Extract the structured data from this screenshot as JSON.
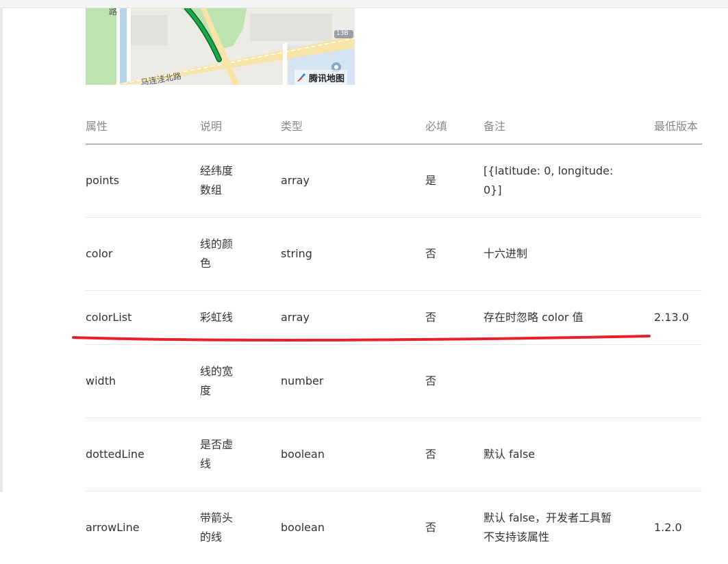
{
  "map": {
    "road_labels": [
      "路",
      "马连洼北路",
      "13B"
    ],
    "brand": "腾讯地图",
    "colors": {
      "route": "#1aa64a",
      "park": "#bfe3b0",
      "water": "#b8d4ec",
      "road": "#f7e4a8"
    }
  },
  "table": {
    "headers": [
      "属性",
      "说明",
      "类型",
      "必填",
      "备注",
      "最低版本"
    ],
    "rows": [
      {
        "name": "points",
        "desc": "经纬度数组",
        "type": "array",
        "required": "是",
        "note": "[{latitude: 0, longitude: 0}]",
        "version": ""
      },
      {
        "name": "color",
        "desc": "线的颜色",
        "type": "string",
        "required": "否",
        "note": "十六进制",
        "version": ""
      },
      {
        "name": "colorList",
        "desc": "彩虹线",
        "type": "array",
        "required": "否",
        "note": "存在时忽略 color 值",
        "version": "2.13.0"
      },
      {
        "name": "width",
        "desc": "线的宽度",
        "type": "number",
        "required": "否",
        "note": "",
        "version": ""
      },
      {
        "name": "dottedLine",
        "desc": "是否虚线",
        "type": "boolean",
        "required": "否",
        "note": "默认 false",
        "version": ""
      },
      {
        "name": "arrowLine",
        "desc": "带箭头的线",
        "type": "boolean",
        "required": "否",
        "note": "默认 false，开发者工具暂不支持该属性",
        "version": "1.2.0"
      }
    ]
  },
  "annotation": {
    "underline_color": "#e8202c"
  },
  "colors": {
    "header_text": "#888888",
    "version_link": "#5d6a8f",
    "body_text": "#333333"
  }
}
